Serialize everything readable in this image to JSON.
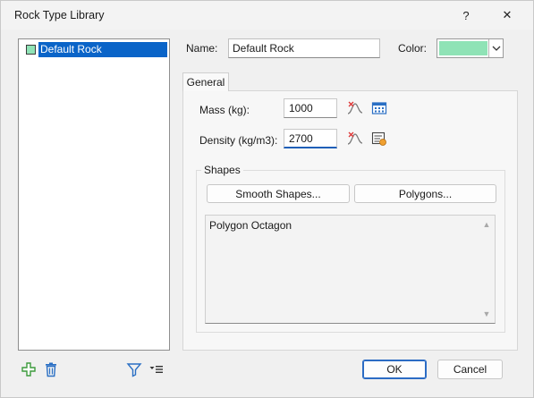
{
  "window": {
    "title": "Rock Type Library",
    "help_glyph": "?",
    "close_glyph": "✕"
  },
  "tree": {
    "items": [
      {
        "label": "Default Rock",
        "swatch_color": "#8fe3b6",
        "selected": true
      }
    ]
  },
  "bottom_toolbar": {
    "icons": [
      "add-icon",
      "delete-icon",
      "filter-icon",
      "filter-menu-icon"
    ]
  },
  "form": {
    "name_label": "Name:",
    "name_value": "Default Rock",
    "color_label": "Color:",
    "color_value": "#8fe3b6"
  },
  "tabs": [
    {
      "label": "General",
      "active": true
    }
  ],
  "general": {
    "mass_label": "Mass (kg):",
    "mass_value": "1000",
    "density_label": "Density (kg/m3):",
    "density_value": "2700",
    "shapes_title": "Shapes",
    "smooth_button": "Smooth Shapes...",
    "polygons_button": "Polygons...",
    "shape_items": [
      "Polygon Octagon"
    ]
  },
  "footer": {
    "ok_label": "OK",
    "cancel_label": "Cancel"
  },
  "colors": {
    "accent": "#0a64c8",
    "rock_color": "#8fe3b6"
  }
}
